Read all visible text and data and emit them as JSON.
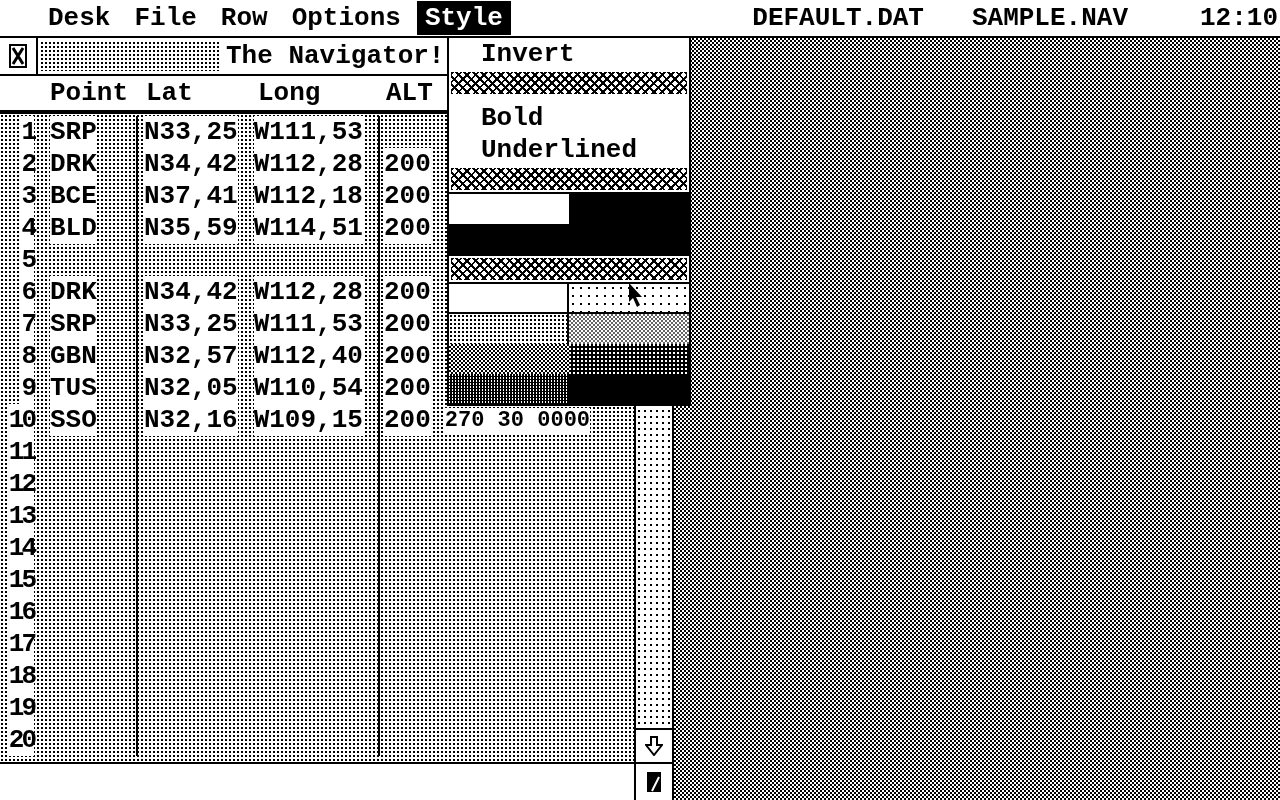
{
  "menu_bar": {
    "menus": [
      {
        "label": "Desk",
        "selected": false
      },
      {
        "label": "File",
        "selected": false
      },
      {
        "label": "Row",
        "selected": false
      },
      {
        "label": "Options",
        "selected": false
      },
      {
        "label": "Style",
        "selected": true
      }
    ],
    "files": [
      "DEFAULT.DAT",
      "SAMPLE.NAV"
    ],
    "clock": "12:10"
  },
  "window": {
    "title": "The Navigator!",
    "columns": [
      "Point",
      "Lat",
      "Long",
      "ALT"
    ],
    "rows": [
      {
        "number": "1",
        "point": "SRP",
        "lat": "N33,25",
        "long": "W111,53"
      },
      {
        "number": "2",
        "point": "DRK",
        "lat": "N34,42",
        "long": "W112,28",
        "alt": "200"
      },
      {
        "number": "3",
        "point": "BCE",
        "lat": "N37,41",
        "long": "W112,18",
        "alt": "200"
      },
      {
        "number": "4",
        "point": "BLD",
        "lat": "N35,59",
        "long": "W114,51",
        "alt": "200"
      },
      {
        "number": "5"
      },
      {
        "number": "6",
        "point": "DRK",
        "lat": "N34,42",
        "long": "W112,28",
        "alt": "200"
      },
      {
        "number": "7",
        "point": "SRP",
        "lat": "N33,25",
        "long": "W111,53",
        "alt": "200"
      },
      {
        "number": "8",
        "point": "GBN",
        "lat": "N32,57",
        "long": "W112,40",
        "alt": "200"
      },
      {
        "number": "9",
        "point": "TUS",
        "lat": "N32,05",
        "long": "W110,54",
        "alt": "200"
      },
      {
        "number": "10",
        "point": "SSO",
        "lat": "N32,16",
        "long": "W109,15",
        "alt": "200",
        "column_6": "270 30 0000"
      },
      {
        "number": "11"
      },
      {
        "number": "12"
      },
      {
        "number": "13"
      },
      {
        "number": "14"
      },
      {
        "number": "15"
      },
      {
        "number": "16"
      },
      {
        "number": "17"
      },
      {
        "number": "18"
      },
      {
        "number": "19"
      },
      {
        "number": "20"
      }
    ]
  },
  "style_menu": {
    "groups": [
      [
        "Invert"
      ],
      [
        "Bold",
        "Underlined"
      ]
    ]
  }
}
